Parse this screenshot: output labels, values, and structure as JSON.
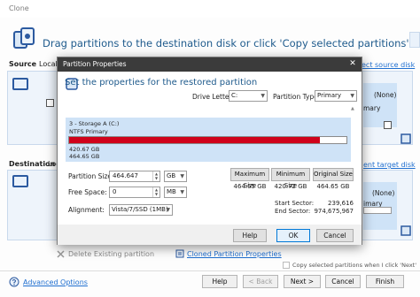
{
  "window": {
    "title": "Clone"
  },
  "heading": "Drag partitions to the destination disk or click 'Copy selected partitions'",
  "source": {
    "label": "Source",
    "tab": "Local d",
    "select_link": "ect source disk"
  },
  "destination": {
    "label": "Destination",
    "tab": "Loc",
    "select_link": "ent target disk"
  },
  "right_panel": {
    "unknown1": "(None)",
    "primary1": "mary",
    "unknown2": "(None)",
    "primary2": "imary"
  },
  "bg_options": {
    "delete_existing": "Delete Existing partition",
    "cloned_props": "Cloned Partition Properties",
    "copy_next": "Copy selected partitions when I click 'Next'"
  },
  "footer": {
    "advanced": "Advanced Options",
    "help": "Help",
    "back": "< Back",
    "next": "Next >",
    "cancel": "Cancel",
    "finish": "Finish"
  },
  "dialog": {
    "title": "Partition Properties",
    "heading": "Set the properties for the restored partition",
    "drive_letter_label": "Drive Letter:",
    "drive_letter_value": "C:",
    "partition_type_label": "Partition Type:",
    "partition_type_value": "Primary",
    "partition": {
      "name": "3 - Storage A (C:)",
      "type": "NTFS Primary",
      "used": "420.67 GB",
      "total": "464.65 GB",
      "used_fraction": 0.905
    },
    "partition_size_label": "Partition Size:",
    "partition_size_value": "464.647",
    "partition_size_unit": "GB",
    "free_space_label": "Free Space:",
    "free_space_value": "0",
    "free_space_unit": "MB",
    "alignment_label": "Alignment:",
    "alignment_value": "Vista/7/SSD (1MB)",
    "max_size_label": "Maximum Size",
    "max_size_value": "464.65 GB",
    "min_size_label": "Minimum Size",
    "min_size_value": "420.72 GB",
    "orig_size_label": "Original Size",
    "orig_size_value": "464.65 GB",
    "start_sector_label": "Start Sector:",
    "start_sector_value": "239,616",
    "end_sector_label": "End Sector:",
    "end_sector_value": "974,675,967",
    "help": "Help",
    "ok": "OK",
    "cancel": "Cancel"
  },
  "colors": {
    "accent_blue": "#1e5a8c",
    "bar_used": "#d0021b",
    "dialog_title": "#3b3b3b",
    "partition_bg": "#cfe3f7"
  }
}
